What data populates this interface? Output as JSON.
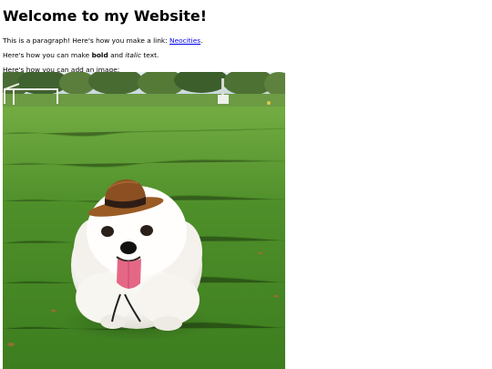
{
  "page": {
    "heading": "Welcome to my Website!",
    "paragraph1": {
      "text": "This is a paragraph! Here's how you make a link: ",
      "link_text": "Neocities",
      "after": "."
    },
    "paragraph2": {
      "before": "Here's how you can make ",
      "bold": "bold",
      "middle": " and ",
      "italic": "italic",
      "after": " text."
    },
    "paragraph3": {
      "text": "Here's how you can add an image:"
    },
    "image": {
      "subject": "white dog wearing a small brown hat sitting on grass",
      "colors": {
        "grass": "#5f9a33",
        "sky": "#d7e3e8",
        "dog": "#f7f5f2",
        "hat": "#8a5326",
        "tongue": "#e06b86"
      }
    }
  }
}
